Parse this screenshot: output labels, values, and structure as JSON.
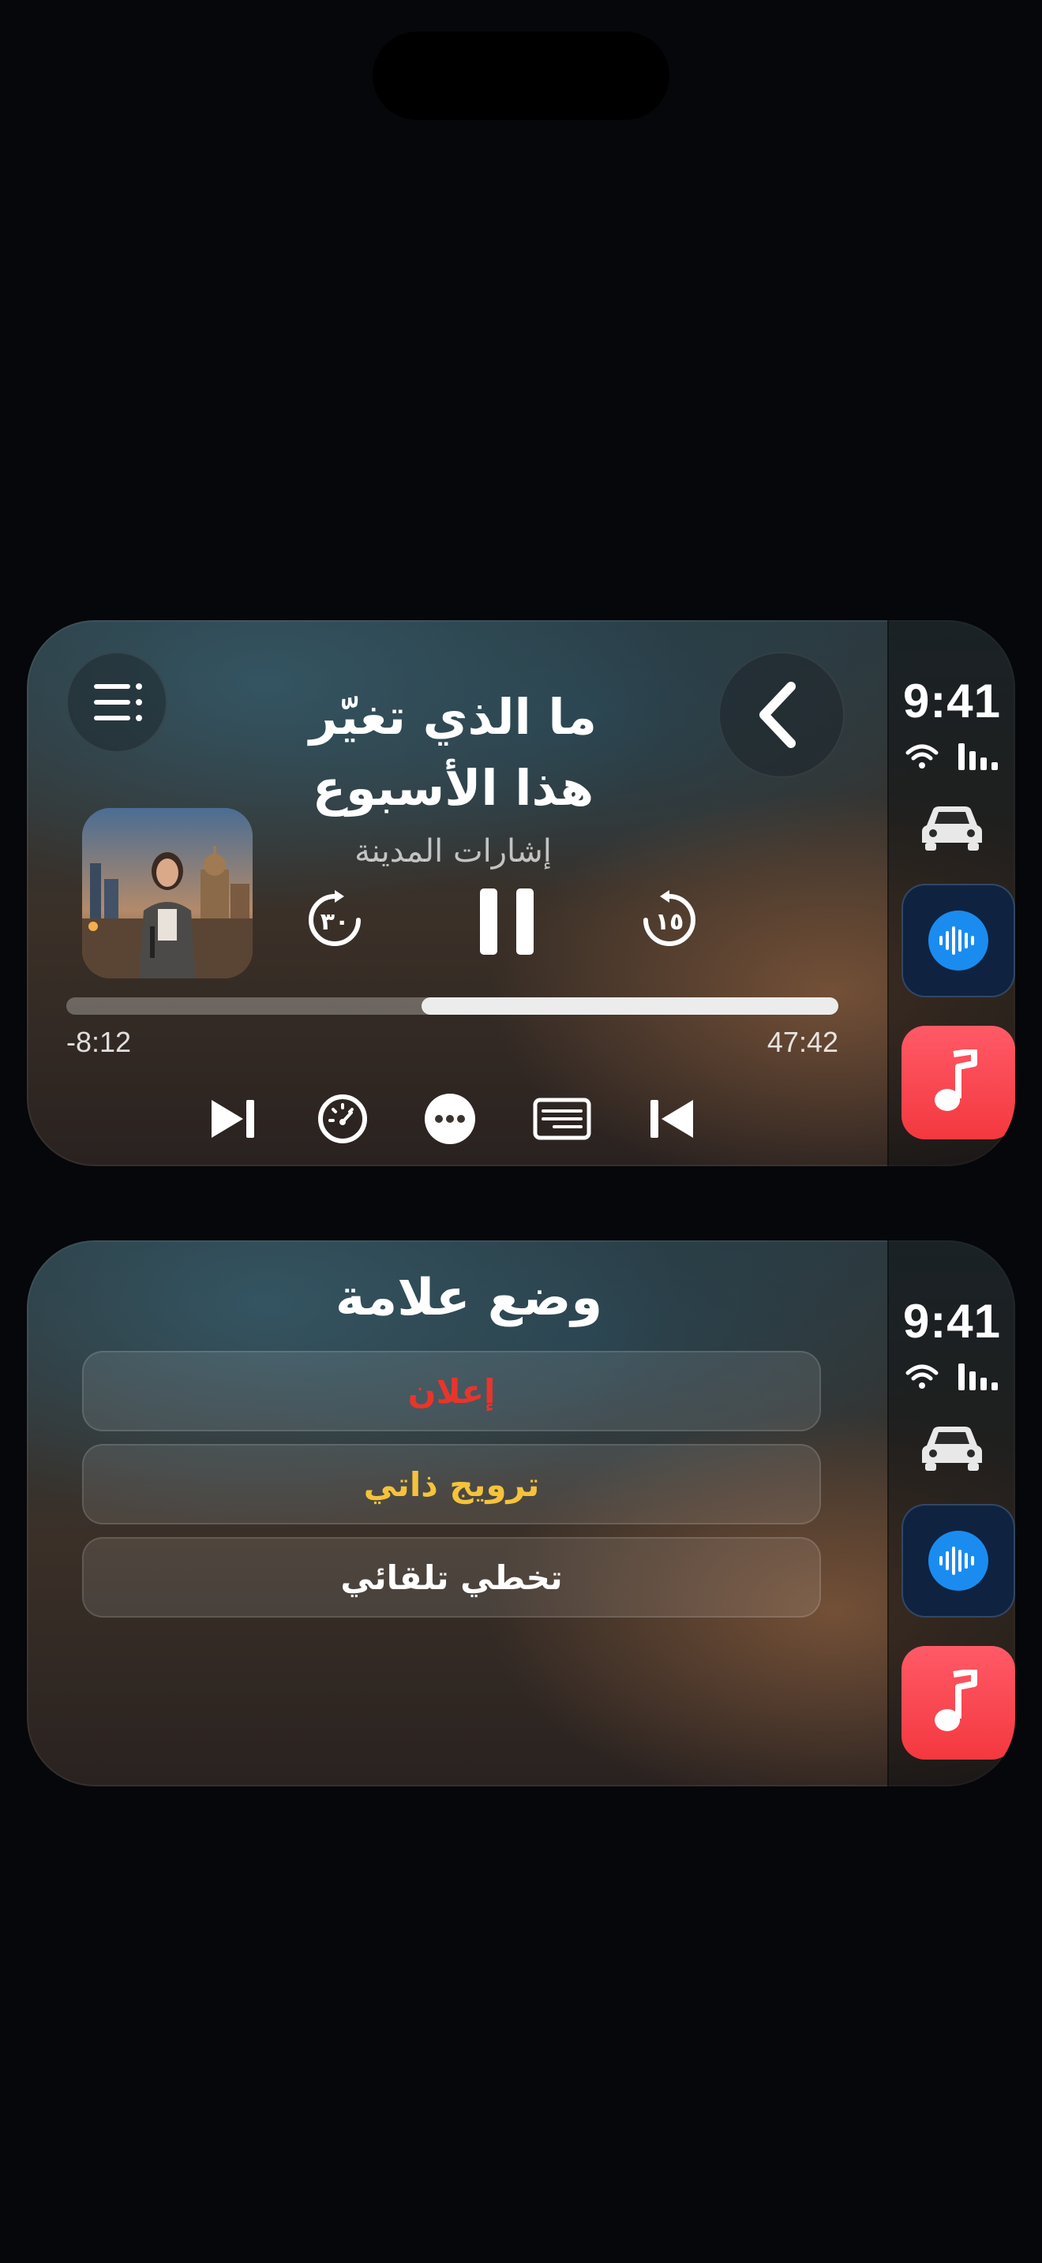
{
  "status": {
    "time": "9:41"
  },
  "player": {
    "title_line1": "ما الذي تغيّر",
    "title_line2": "هذا الأسبوع",
    "show": "إشارات المدينة",
    "elapsed": "47:42",
    "remaining": "-8:12",
    "progress": 0.54,
    "skip_back_seconds": "١٥",
    "skip_forward_seconds": "٣٠"
  },
  "marker": {
    "title": "وضع علامة",
    "options": [
      {
        "label": "إعلان",
        "color": "#e8352b"
      },
      {
        "label": "ترويج ذاتي",
        "color": "#f5c33b"
      },
      {
        "label": "تخطي تلقائي",
        "color": "#ffffff"
      }
    ]
  },
  "sidebar": {
    "apps": [
      "car-icon",
      "podcasts-app-icon",
      "music-app-icon"
    ],
    "accent_podcasts": "#1a8cf0",
    "accent_music": "#f4383f"
  }
}
